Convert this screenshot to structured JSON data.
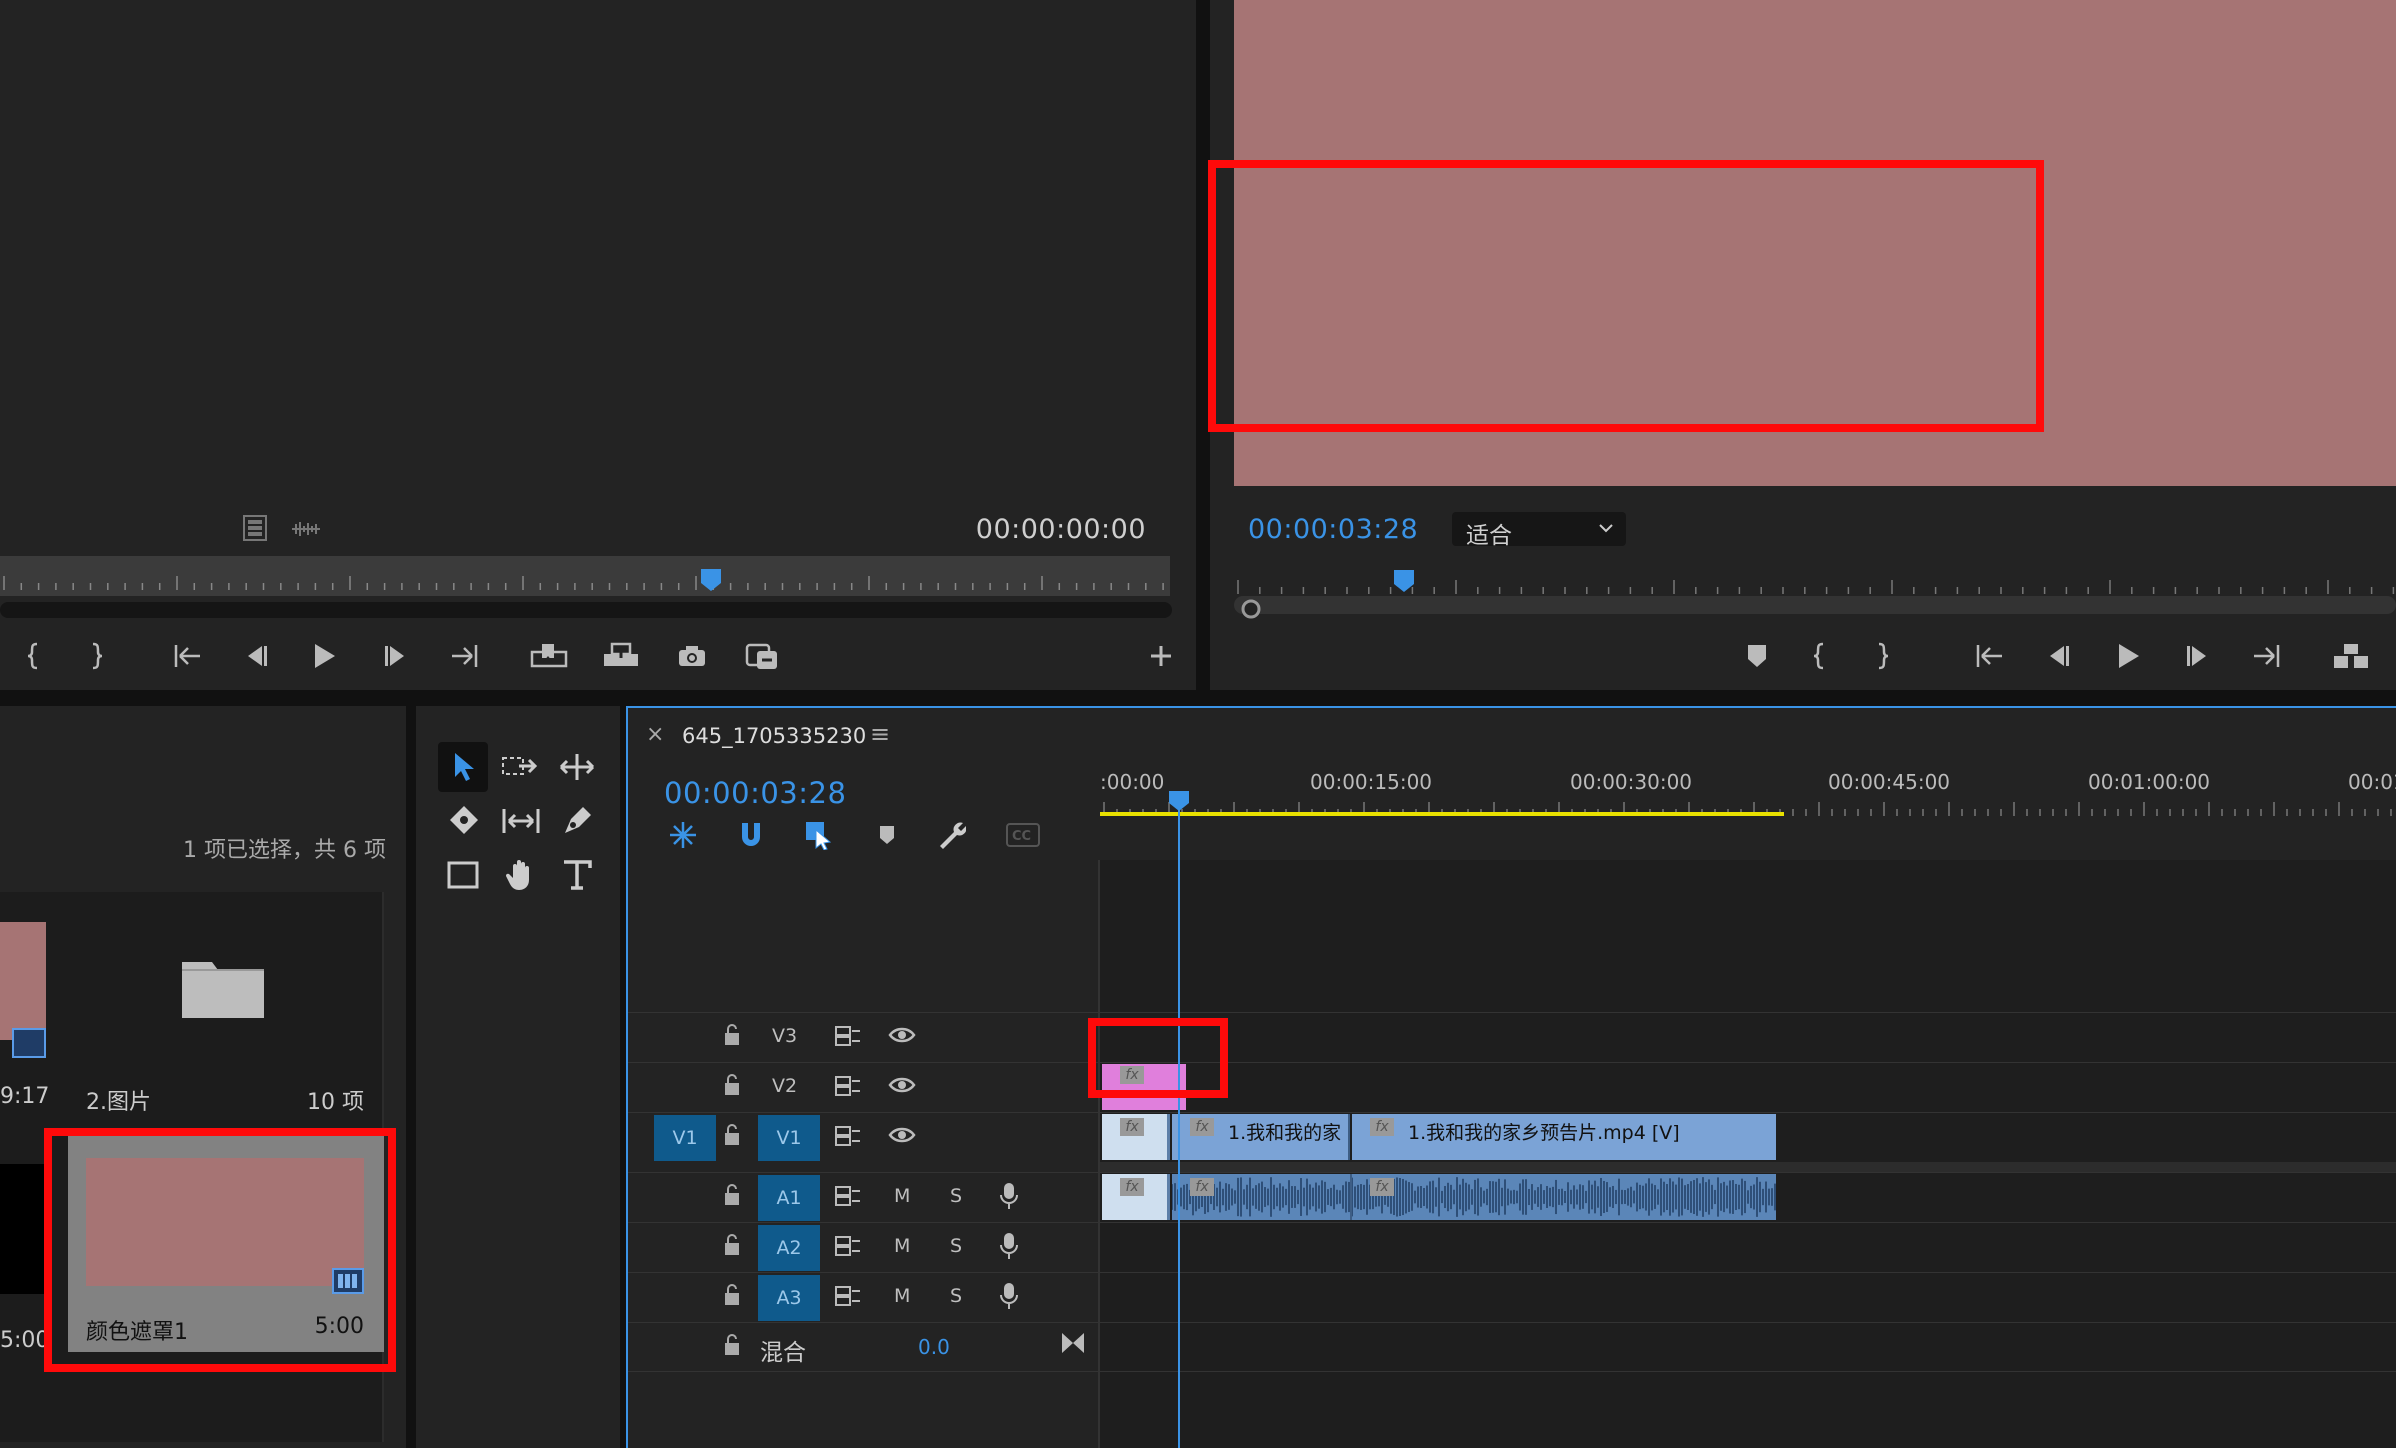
{
  "source_monitor": {
    "timecode": "00:00:00:00",
    "icons": [
      "clip-icon",
      "audio-waveform-icon"
    ],
    "buttons": [
      "mark-in",
      "mark-out",
      "go-to-in",
      "step-back",
      "play",
      "step-forward",
      "go-to-out",
      "insert",
      "overwrite",
      "export-frame",
      "loop",
      "add"
    ]
  },
  "program_monitor": {
    "timecode": "00:00:03:28",
    "zoom_value": "适合",
    "buttons": [
      "add-marker",
      "mark-in",
      "mark-out",
      "go-to-in",
      "step-back",
      "play",
      "step-forward",
      "go-to-out",
      "lift"
    ]
  },
  "project_panel": {
    "selection_status": "1 项已选择，共 6 项",
    "items": [
      {
        "name": "",
        "duration": "9:17",
        "kind": "clip"
      },
      {
        "name": "2.图片",
        "duration": "10 项",
        "kind": "bin"
      },
      {
        "name": "",
        "duration": "5:00",
        "kind": "clip"
      },
      {
        "name": "颜色遮罩1",
        "duration": "5:00",
        "kind": "color-matte"
      }
    ]
  },
  "tools": [
    "selection",
    "track-select-forward",
    "ripple-edit",
    "razor",
    "slip",
    "pen",
    "rectangle",
    "hand",
    "type"
  ],
  "timeline": {
    "sequence_name": "645_1705335230",
    "close_glyph": "×",
    "menu_glyph": "≡",
    "timecode": "00:00:03:28",
    "ruler_labels": [
      ":00:00",
      "00:00:15:00",
      "00:00:30:00",
      "00:00:45:00",
      "00:01:00:00",
      "00:01"
    ],
    "video_tracks": [
      {
        "name": "V3",
        "source": ""
      },
      {
        "name": "V2",
        "source": ""
      },
      {
        "name": "V1",
        "source": "V1"
      }
    ],
    "audio_tracks": [
      {
        "name": "A1",
        "m": "M",
        "s": "S"
      },
      {
        "name": "A2",
        "m": "M",
        "s": "S"
      },
      {
        "name": "A3",
        "m": "M",
        "s": "S"
      }
    ],
    "mix": {
      "label": "混合",
      "value": "0.0"
    },
    "clips": {
      "v1_clip_a": "1.我和我的家",
      "v1_clip_b": "1.我和我的家乡预告片.mp4 [V]",
      "fx": "fx"
    }
  },
  "colors": {
    "accent_blue": "#3a93e6",
    "highlight_red": "#ff0a0a",
    "matte_color": "#a67474",
    "v2_clip": "#e07fdc",
    "video_clip": "#7ba3d6",
    "audio_clip": "#5b86b8",
    "work_area": "#e8e000"
  }
}
